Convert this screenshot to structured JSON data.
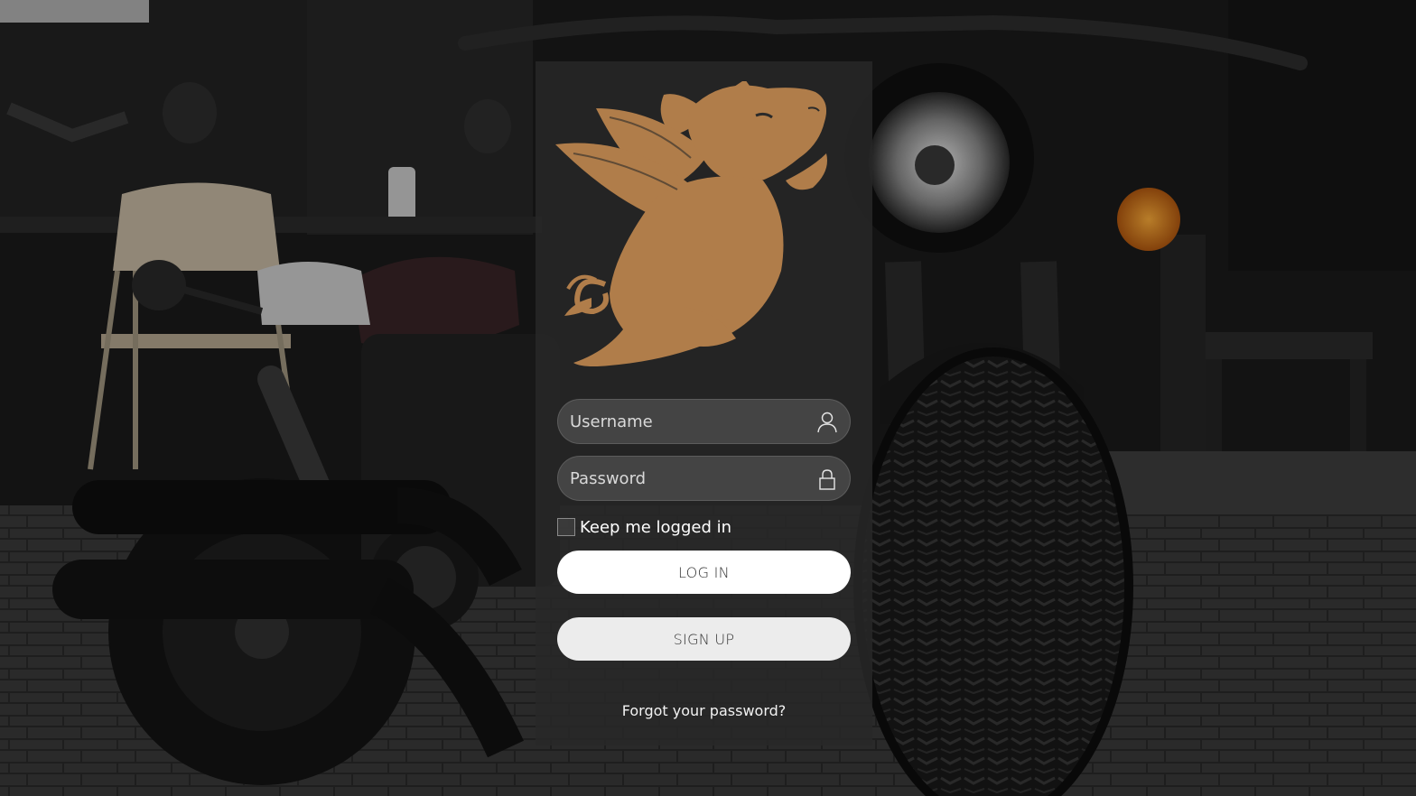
{
  "login": {
    "username_placeholder": "Username",
    "password_placeholder": "Password",
    "keep_logged_in_label": "Keep me logged in",
    "login_button_label": "LOG IN",
    "signup_button_label": "SIGN UP",
    "forgot_password_link": "Forgot your password?"
  },
  "icons": {
    "logo": "flying-pig-logo",
    "username_field": "user-icon",
    "password_field": "lock-icon"
  },
  "colors": {
    "logo": "#b07d4a",
    "panel_background": "#282828",
    "login_button": "#ffffff",
    "signup_button": "#ececec"
  }
}
